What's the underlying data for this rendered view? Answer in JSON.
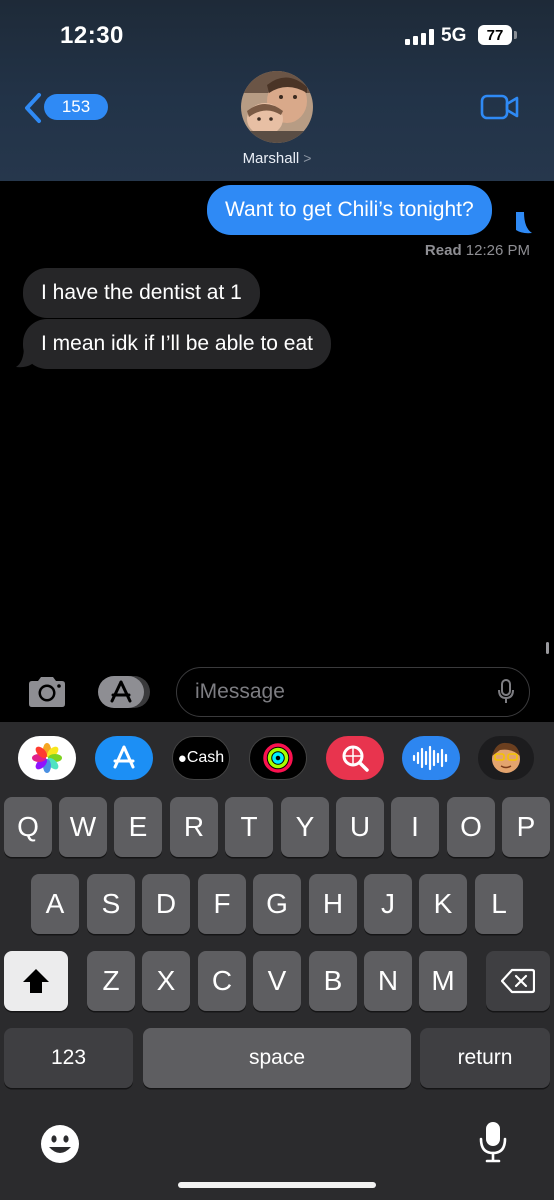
{
  "status_bar": {
    "time": "12:30",
    "network": "5G",
    "battery": "77"
  },
  "header": {
    "back_count": "153",
    "contact_name": "Marshall",
    "contact_chevron": ">"
  },
  "messages": [
    {
      "direction": "outgoing",
      "text": "Want to get Chili’s tonight?"
    },
    {
      "direction": "incoming",
      "text": "I have the dentist at 1"
    },
    {
      "direction": "incoming",
      "text": "I mean idk if I’ll be able to eat"
    }
  ],
  "read_receipt": {
    "label": "Read",
    "time": "12:26 PM"
  },
  "composer": {
    "placeholder": "iMessage"
  },
  "app_strip": [
    {
      "icon": "photos-icon"
    },
    {
      "icon": "app-store-icon"
    },
    {
      "icon": "apple-cash-icon",
      "label": "Cash"
    },
    {
      "icon": "activity-icon"
    },
    {
      "icon": "image-search-icon"
    },
    {
      "icon": "audio-message-icon"
    },
    {
      "icon": "memoji-icon"
    }
  ],
  "keyboard": {
    "row1": [
      "Q",
      "W",
      "E",
      "R",
      "T",
      "Y",
      "U",
      "I",
      "O",
      "P"
    ],
    "row2": [
      "A",
      "S",
      "D",
      "F",
      "G",
      "H",
      "J",
      "K",
      "L"
    ],
    "row3": [
      "Z",
      "X",
      "C",
      "V",
      "B",
      "N",
      "M"
    ],
    "numbers_label": "123",
    "space_label": "space",
    "return_label": "return"
  },
  "colors": {
    "accent": "#2f8af5",
    "incoming_bubble": "#262628",
    "keyboard_bg": "#2b2b2d",
    "key": "#5e5e61"
  }
}
